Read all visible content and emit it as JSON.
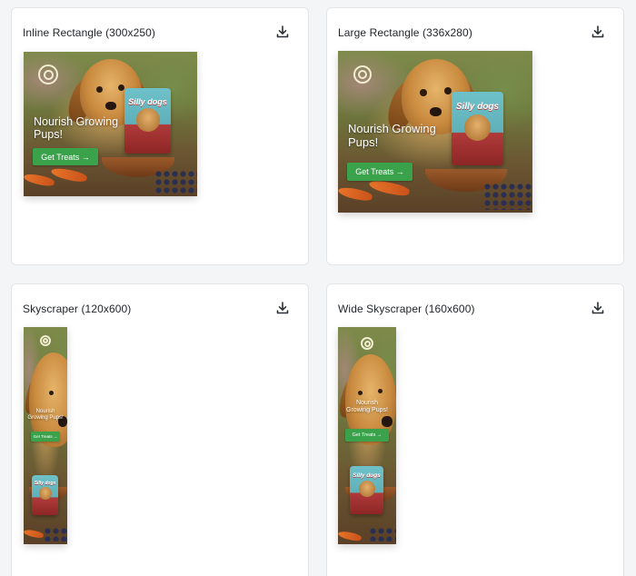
{
  "cards": [
    {
      "title": "Inline Rectangle (300x250)",
      "download_icon": "download-icon"
    },
    {
      "title": "Large Rectangle (336x280)",
      "download_icon": "download-icon"
    },
    {
      "title": "Skyscraper (120x600)",
      "download_icon": "download-icon"
    },
    {
      "title": "Wide Skyscraper (160x600)",
      "download_icon": "download-icon"
    }
  ],
  "ad": {
    "headline": "Nourish Growing Pups!",
    "cta": "Get Treats →",
    "product_brand": "Silly dogs",
    "colors": {
      "cta_green": "#3aa24a",
      "bag_teal": "#6fc1c9",
      "bag_red": "#b03a3a",
      "logo": "#f1edd2"
    }
  }
}
